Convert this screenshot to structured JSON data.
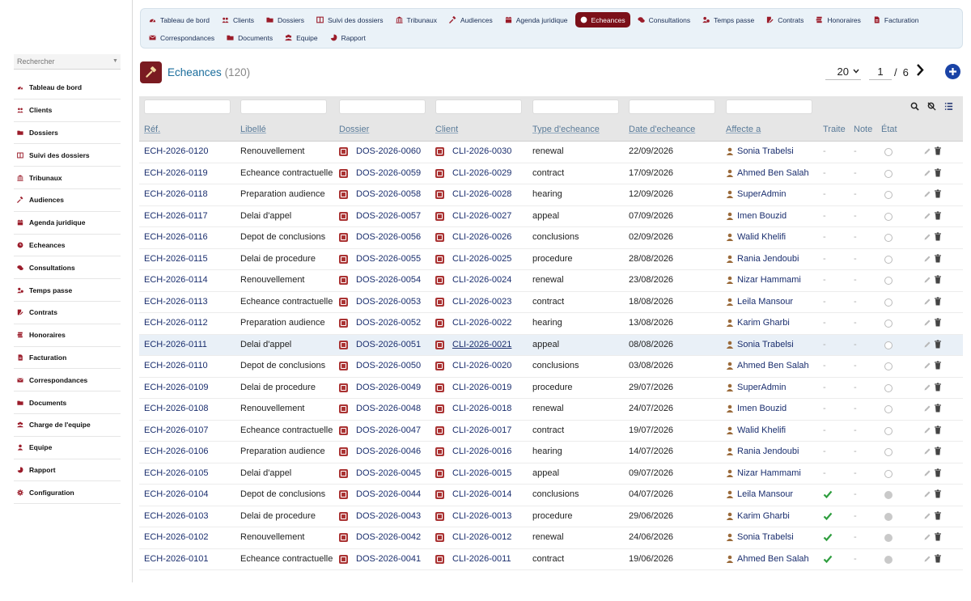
{
  "sidebar": {
    "search_placeholder": "Rechercher",
    "items": [
      {
        "label": "Tableau de bord",
        "icon": "dashboard-icon"
      },
      {
        "label": "Clients",
        "icon": "users-icon"
      },
      {
        "label": "Dossiers",
        "icon": "folder-icon"
      },
      {
        "label": "Suivi des dossiers",
        "icon": "columns-icon"
      },
      {
        "label": "Tribunaux",
        "icon": "bank-icon"
      },
      {
        "label": "Audiences",
        "icon": "gavel-icon"
      },
      {
        "label": "Agenda juridique",
        "icon": "calendar-icon"
      },
      {
        "label": "Echeances",
        "icon": "clock-icon"
      },
      {
        "label": "Consultations",
        "icon": "comments-icon"
      },
      {
        "label": "Temps passe",
        "icon": "user-clock-icon"
      },
      {
        "label": "Contrats",
        "icon": "contract-icon"
      },
      {
        "label": "Honoraires",
        "icon": "money-icon"
      },
      {
        "label": "Facturation",
        "icon": "invoice-icon"
      },
      {
        "label": "Correspondances",
        "icon": "envelope-icon"
      },
      {
        "label": "Documents",
        "icon": "folder-icon"
      },
      {
        "label": "Charge de l'equipe",
        "icon": "team-icon"
      },
      {
        "label": "Equipe",
        "icon": "user-icon"
      },
      {
        "label": "Rapport",
        "icon": "pie-chart-icon"
      },
      {
        "label": "Configuration",
        "icon": "gear-icon"
      }
    ]
  },
  "topnav": {
    "row1": [
      {
        "label": "Tableau de bord",
        "icon": "dashboard-icon"
      },
      {
        "label": "Clients",
        "icon": "users-icon"
      },
      {
        "label": "Dossiers",
        "icon": "folder-icon"
      },
      {
        "label": "Suivi des dossiers",
        "icon": "columns-icon"
      },
      {
        "label": "Tribunaux",
        "icon": "bank-icon"
      },
      {
        "label": "Audiences",
        "icon": "gavel-icon"
      },
      {
        "label": "Agenda juridique",
        "icon": "calendar-icon"
      },
      {
        "label": "Echeances",
        "icon": "clock-icon",
        "active": true
      },
      {
        "label": "Consultations",
        "icon": "comments-icon"
      },
      {
        "label": "Temps passe",
        "icon": "user-clock-icon"
      },
      {
        "label": "Contrats",
        "icon": "contract-icon"
      },
      {
        "label": "Honoraires",
        "icon": "money-icon"
      },
      {
        "label": "Facturation",
        "icon": "invoice-icon"
      }
    ],
    "row2": [
      {
        "label": "Correspondances",
        "icon": "envelope-icon"
      },
      {
        "label": "Documents",
        "icon": "folder-icon"
      },
      {
        "label": "Equipe",
        "icon": "team-icon"
      },
      {
        "label": "Rapport",
        "icon": "pie-chart-icon"
      }
    ]
  },
  "page": {
    "title": "Echeances",
    "count": "(120)",
    "page_size": "20",
    "page_number": "1",
    "page_sep": "/",
    "page_total": "6"
  },
  "table": {
    "columns": [
      "Réf.",
      "Libellé",
      "Dossier",
      "Client",
      "Type d'echeance",
      "Date d'echeance",
      "Affecte a",
      "Traite",
      "Note",
      "État"
    ],
    "rows": [
      {
        "ref": "ECH-2026-0120",
        "libelle": "Renouvellement",
        "dossier": "DOS-2026-0060",
        "client": "CLI-2026-0030",
        "type": "renewal",
        "date": "22/09/2026",
        "assignee": "Sonia Trabelsi",
        "traite": "-",
        "note": "-",
        "done": false
      },
      {
        "ref": "ECH-2026-0119",
        "libelle": "Echeance contractuelle",
        "dossier": "DOS-2026-0059",
        "client": "CLI-2026-0029",
        "type": "contract",
        "date": "17/09/2026",
        "assignee": "Ahmed Ben Salah",
        "traite": "-",
        "note": "-",
        "done": false
      },
      {
        "ref": "ECH-2026-0118",
        "libelle": "Preparation audience",
        "dossier": "DOS-2026-0058",
        "client": "CLI-2026-0028",
        "type": "hearing",
        "date": "12/09/2026",
        "assignee": "SuperAdmin",
        "traite": "-",
        "note": "-",
        "done": false
      },
      {
        "ref": "ECH-2026-0117",
        "libelle": "Delai d'appel",
        "dossier": "DOS-2026-0057",
        "client": "CLI-2026-0027",
        "type": "appeal",
        "date": "07/09/2026",
        "assignee": "Imen Bouzid",
        "traite": "-",
        "note": "-",
        "done": false
      },
      {
        "ref": "ECH-2026-0116",
        "libelle": "Depot de conclusions",
        "dossier": "DOS-2026-0056",
        "client": "CLI-2026-0026",
        "type": "conclusions",
        "date": "02/09/2026",
        "assignee": "Walid Khelifi",
        "traite": "-",
        "note": "-",
        "done": false
      },
      {
        "ref": "ECH-2026-0115",
        "libelle": "Delai de procedure",
        "dossier": "DOS-2026-0055",
        "client": "CLI-2026-0025",
        "type": "procedure",
        "date": "28/08/2026",
        "assignee": "Rania Jendoubi",
        "traite": "-",
        "note": "-",
        "done": false
      },
      {
        "ref": "ECH-2026-0114",
        "libelle": "Renouvellement",
        "dossier": "DOS-2026-0054",
        "client": "CLI-2026-0024",
        "type": "renewal",
        "date": "23/08/2026",
        "assignee": "Nizar Hammami",
        "traite": "-",
        "note": "-",
        "done": false
      },
      {
        "ref": "ECH-2026-0113",
        "libelle": "Echeance contractuelle",
        "dossier": "DOS-2026-0053",
        "client": "CLI-2026-0023",
        "type": "contract",
        "date": "18/08/2026",
        "assignee": "Leila Mansour",
        "traite": "-",
        "note": "-",
        "done": false
      },
      {
        "ref": "ECH-2026-0112",
        "libelle": "Preparation audience",
        "dossier": "DOS-2026-0052",
        "client": "CLI-2026-0022",
        "type": "hearing",
        "date": "13/08/2026",
        "assignee": "Karim Gharbi",
        "traite": "-",
        "note": "-",
        "done": false
      },
      {
        "ref": "ECH-2026-0111",
        "libelle": "Delai d'appel",
        "dossier": "DOS-2026-0051",
        "client": "CLI-2026-0021",
        "type": "appeal",
        "date": "08/08/2026",
        "assignee": "Sonia Trabelsi",
        "traite": "-",
        "note": "-",
        "done": false
      },
      {
        "ref": "ECH-2026-0110",
        "libelle": "Depot de conclusions",
        "dossier": "DOS-2026-0050",
        "client": "CLI-2026-0020",
        "type": "conclusions",
        "date": "03/08/2026",
        "assignee": "Ahmed Ben Salah",
        "traite": "-",
        "note": "-",
        "done": false
      },
      {
        "ref": "ECH-2026-0109",
        "libelle": "Delai de procedure",
        "dossier": "DOS-2026-0049",
        "client": "CLI-2026-0019",
        "type": "procedure",
        "date": "29/07/2026",
        "assignee": "SuperAdmin",
        "traite": "-",
        "note": "-",
        "done": false
      },
      {
        "ref": "ECH-2026-0108",
        "libelle": "Renouvellement",
        "dossier": "DOS-2026-0048",
        "client": "CLI-2026-0018",
        "type": "renewal",
        "date": "24/07/2026",
        "assignee": "Imen Bouzid",
        "traite": "-",
        "note": "-",
        "done": false
      },
      {
        "ref": "ECH-2026-0107",
        "libelle": "Echeance contractuelle",
        "dossier": "DOS-2026-0047",
        "client": "CLI-2026-0017",
        "type": "contract",
        "date": "19/07/2026",
        "assignee": "Walid Khelifi",
        "traite": "-",
        "note": "-",
        "done": false
      },
      {
        "ref": "ECH-2026-0106",
        "libelle": "Preparation audience",
        "dossier": "DOS-2026-0046",
        "client": "CLI-2026-0016",
        "type": "hearing",
        "date": "14/07/2026",
        "assignee": "Rania Jendoubi",
        "traite": "-",
        "note": "-",
        "done": false
      },
      {
        "ref": "ECH-2026-0105",
        "libelle": "Delai d'appel",
        "dossier": "DOS-2026-0045",
        "client": "CLI-2026-0015",
        "type": "appeal",
        "date": "09/07/2026",
        "assignee": "Nizar Hammami",
        "traite": "-",
        "note": "-",
        "done": false
      },
      {
        "ref": "ECH-2026-0104",
        "libelle": "Depot de conclusions",
        "dossier": "DOS-2026-0044",
        "client": "CLI-2026-0014",
        "type": "conclusions",
        "date": "04/07/2026",
        "assignee": "Leila Mansour",
        "traite": "check",
        "note": "-",
        "done": true
      },
      {
        "ref": "ECH-2026-0103",
        "libelle": "Delai de procedure",
        "dossier": "DOS-2026-0043",
        "client": "CLI-2026-0013",
        "type": "procedure",
        "date": "29/06/2026",
        "assignee": "Karim Gharbi",
        "traite": "check",
        "note": "-",
        "done": true
      },
      {
        "ref": "ECH-2026-0102",
        "libelle": "Renouvellement",
        "dossier": "DOS-2026-0042",
        "client": "CLI-2026-0012",
        "type": "renewal",
        "date": "24/06/2026",
        "assignee": "Sonia Trabelsi",
        "traite": "check",
        "note": "-",
        "done": true
      },
      {
        "ref": "ECH-2026-0101",
        "libelle": "Echeance contractuelle",
        "dossier": "DOS-2026-0041",
        "client": "CLI-2026-0011",
        "type": "contract",
        "date": "19/06/2026",
        "assignee": "Ahmed Ben Salah",
        "traite": "check",
        "note": "-",
        "done": true
      }
    ]
  },
  "colors": {
    "accent": "#7b1019",
    "link": "#1a2e6e",
    "title": "#1a6d9c",
    "check": "#2e9e3e",
    "add": "#1a43a6"
  }
}
